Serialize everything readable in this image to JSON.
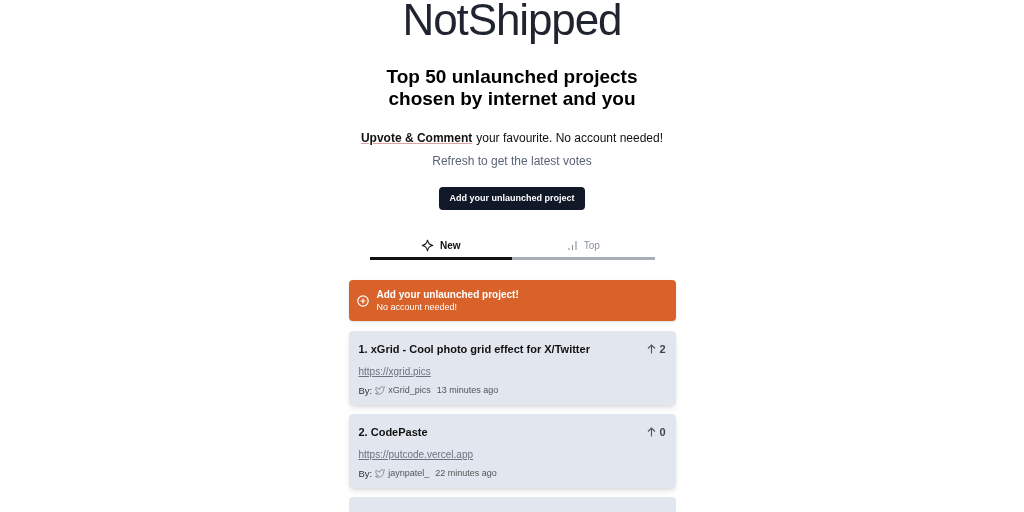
{
  "logo": "NotShipped",
  "headline": "Top 50 unlaunched projects chosen by internet and you",
  "intro": {
    "link": "Upvote & Comment",
    "text": "your favourite. No account needed!"
  },
  "refresh_note": "Refresh to get the latest votes",
  "add_button": "Add your unlaunched project",
  "tabs": [
    {
      "label": "New",
      "kind": "new",
      "selected": true
    },
    {
      "label": "Top",
      "kind": "top",
      "selected": false
    }
  ],
  "banner": {
    "title": "Add your unlaunched project!",
    "subtitle": "No account needed!"
  },
  "projects": [
    {
      "title": "1. xGrid - Cool photo grid effect for X/Twitter",
      "votes": "2",
      "url": "https://xgrid.pics",
      "by_label": "By:",
      "author": "xGrid_pics",
      "time": "13 minutes ago"
    },
    {
      "title": "2. CodePaste",
      "votes": "0",
      "url": "https://putcode.vercel.app",
      "by_label": "By:",
      "author": "jaynpatel_",
      "time": "22 minutes ago"
    }
  ]
}
